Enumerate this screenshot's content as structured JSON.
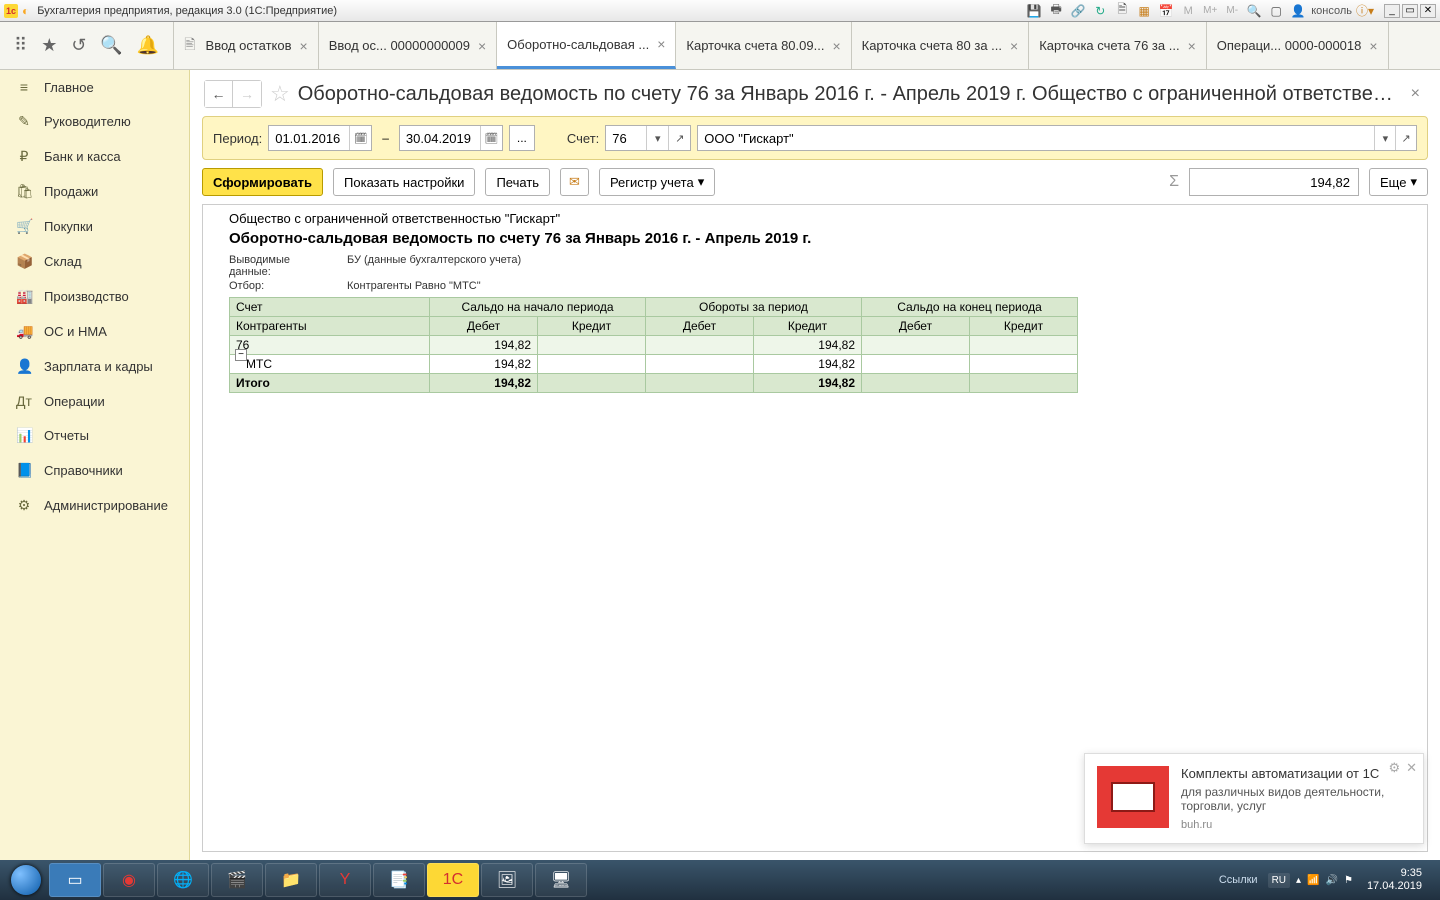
{
  "window": {
    "title": "Бухгалтерия предприятия, редакция 3.0  (1С:Предприятие)",
    "user": "консоль"
  },
  "toolbar_chars": {
    "m1": "М",
    "mp": "М+",
    "mm": "М-"
  },
  "tabs": [
    {
      "label": "Ввод остатков",
      "active": false
    },
    {
      "label": "Ввод ос... 00000000009",
      "active": false
    },
    {
      "label": "Оборотно-сальдовая ...",
      "active": true
    },
    {
      "label": "Карточка счета 80.09...",
      "active": false
    },
    {
      "label": "Карточка счета 80 за ...",
      "active": false
    },
    {
      "label": "Карточка счета 76 за ...",
      "active": false
    },
    {
      "label": "Операци... 0000-000018",
      "active": false
    }
  ],
  "sidebar": [
    {
      "icon": "≡",
      "label": "Главное"
    },
    {
      "icon": "✎",
      "label": "Руководителю"
    },
    {
      "icon": "₽",
      "label": "Банк и касса"
    },
    {
      "icon": "🛍",
      "label": "Продажи"
    },
    {
      "icon": "🛒",
      "label": "Покупки"
    },
    {
      "icon": "📦",
      "label": "Склад"
    },
    {
      "icon": "🏭",
      "label": "Производство"
    },
    {
      "icon": "🚚",
      "label": "ОС и НМА"
    },
    {
      "icon": "👤",
      "label": "Зарплата и кадры"
    },
    {
      "icon": "Дт",
      "label": "Операции"
    },
    {
      "icon": "📊",
      "label": "Отчеты"
    },
    {
      "icon": "📘",
      "label": "Справочники"
    },
    {
      "icon": "⚙",
      "label": "Администрирование"
    }
  ],
  "page": {
    "title": "Оборотно-сальдовая ведомость по счету 76 за Январь 2016 г. - Апрель 2019 г. Общество с ограниченной ответственн..."
  },
  "filter": {
    "period_label": "Период:",
    "date_from": "01.01.2016",
    "date_to": "30.04.2019",
    "account_label": "Счет:",
    "account": "76",
    "org": "ООО \"Гискарт\""
  },
  "actions": {
    "generate": "Сформировать",
    "settings": "Показать настройки",
    "print": "Печать",
    "register": "Регистр учета",
    "more": "Еще",
    "total": "194,82"
  },
  "report": {
    "org": "Общество с ограниченной ответственностью \"Гискарт\"",
    "title": "Оборотно-сальдовая ведомость по счету 76 за Январь 2016 г. - Апрель 2019 г.",
    "out_label": "Выводимые данные:",
    "out_value": "БУ (данные бухгалтерского учета)",
    "filter_label": "Отбор:",
    "filter_value": "Контрагенты Равно \"МТС\"",
    "headers": {
      "account": "Счет",
      "contr": "Контрагенты",
      "open": "Сальдо на начало периода",
      "turn": "Обороты за период",
      "close": "Сальдо на конец периода",
      "debit": "Дебет",
      "credit": "Кредит"
    },
    "rows": [
      {
        "kind": "data",
        "name": "76",
        "open_d": "194,82",
        "open_c": "",
        "turn_d": "",
        "turn_c": "194,82",
        "close_d": "",
        "close_c": ""
      },
      {
        "kind": "sub",
        "name": "МТС",
        "open_d": "194,82",
        "open_c": "",
        "turn_d": "",
        "turn_c": "194,82",
        "close_d": "",
        "close_c": ""
      },
      {
        "kind": "total",
        "name": "Итого",
        "open_d": "194,82",
        "open_c": "",
        "turn_d": "",
        "turn_c": "194,82",
        "close_d": "",
        "close_c": ""
      }
    ]
  },
  "notification": {
    "title": "Комплекты автоматизации от 1С",
    "body": "для различных видов деятельности, торговли, услуг",
    "source": "buh.ru"
  },
  "taskbar": {
    "links": "Ссылки",
    "lang": "RU",
    "time": "9:35",
    "date": "17.04.2019"
  }
}
